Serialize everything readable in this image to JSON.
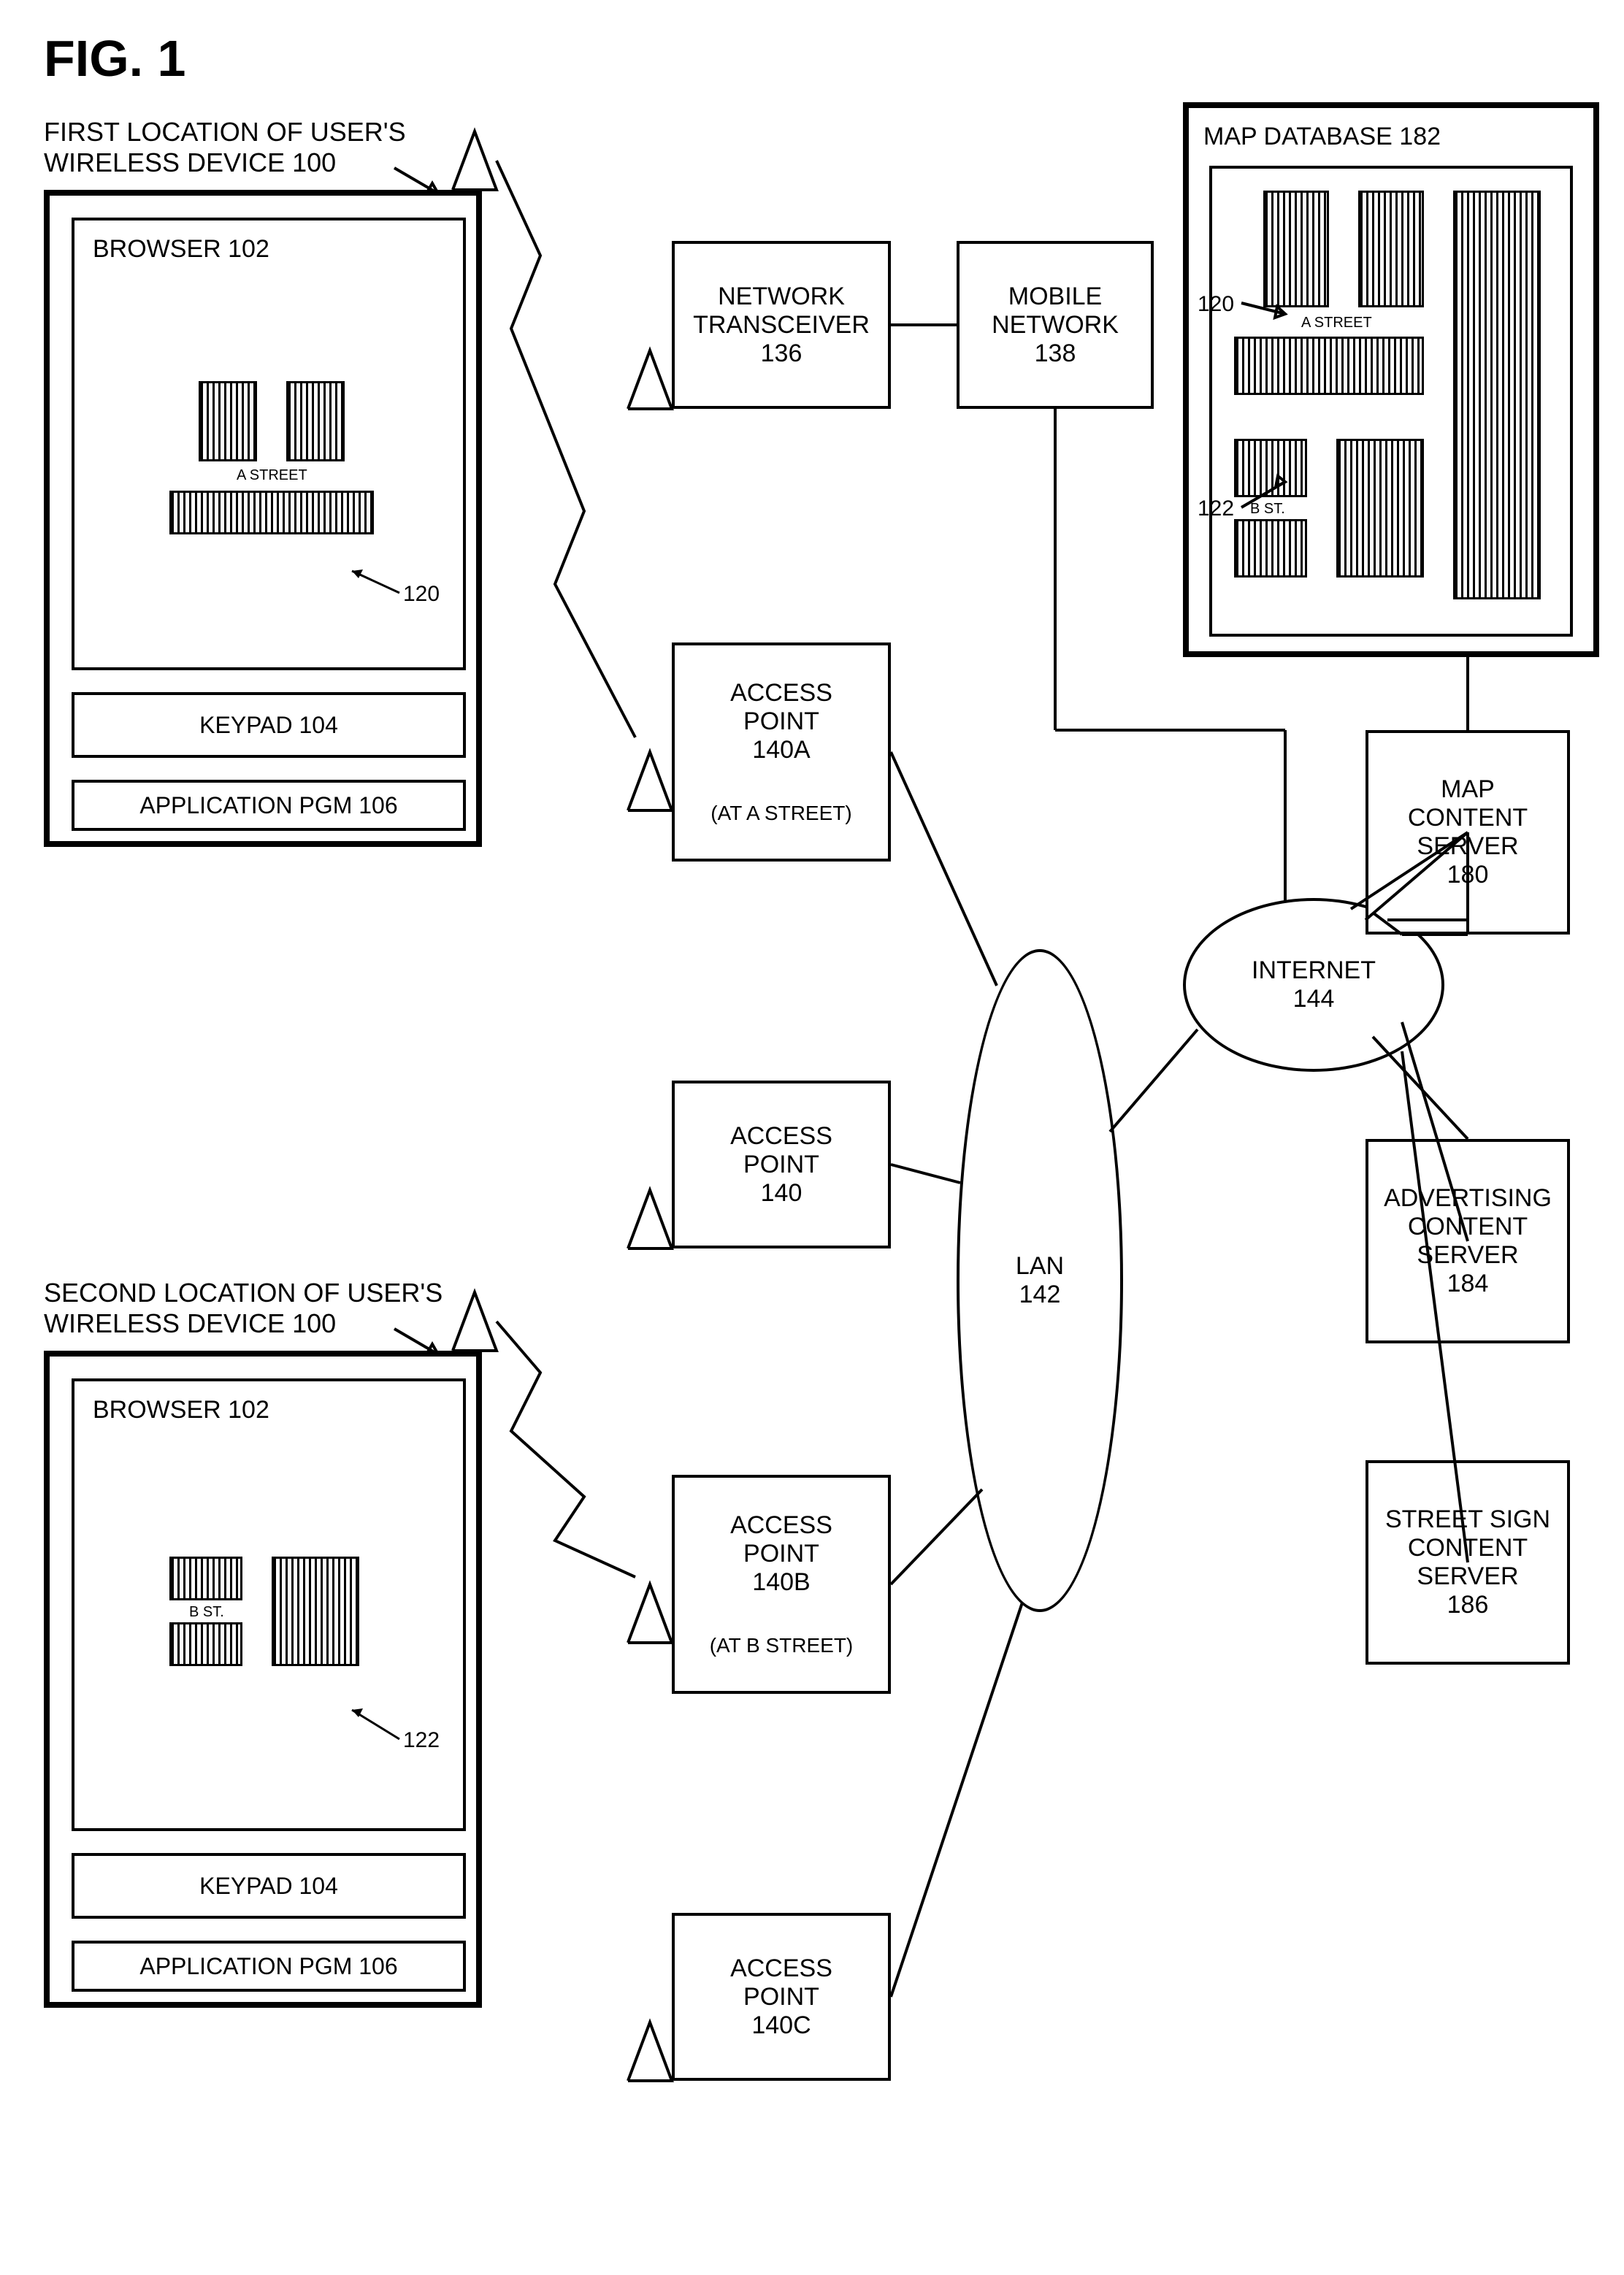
{
  "figure": "FIG. 1",
  "devices": {
    "device1": {
      "title_line1": "FIRST LOCATION OF USER'S",
      "title_line2": "WIRELESS DEVICE 100",
      "browser": "BROWSER 102",
      "keypad": "KEYPAD 104",
      "app": "APPLICATION PGM 106",
      "street": "A STREET",
      "ref": "120"
    },
    "device2": {
      "title_line1": "SECOND LOCATION OF USER'S",
      "title_line2": "WIRELESS DEVICE 100",
      "browser": "BROWSER 102",
      "keypad": "KEYPAD 104",
      "app": "APPLICATION PGM 106",
      "street": "B ST.",
      "ref": "122"
    }
  },
  "nodes": {
    "network_transceiver": {
      "l1": "NETWORK",
      "l2": "TRANSCEIVER",
      "l3": "136"
    },
    "mobile_network": {
      "l1": "MOBILE",
      "l2": "NETWORK",
      "l3": "138"
    },
    "ap140a": {
      "l1": "ACCESS",
      "l2": "POINT",
      "l3": "140A",
      "loc": "(AT A STREET)"
    },
    "ap140": {
      "l1": "ACCESS",
      "l2": "POINT",
      "l3": "140"
    },
    "ap140b": {
      "l1": "ACCESS",
      "l2": "POINT",
      "l3": "140B",
      "loc": "(AT B STREET)"
    },
    "ap140c": {
      "l1": "ACCESS",
      "l2": "POINT",
      "l3": "140C"
    },
    "lan": {
      "l1": "LAN",
      "l2": "142"
    },
    "internet": {
      "l1": "INTERNET",
      "l2": "144"
    },
    "map_server": {
      "l1": "MAP",
      "l2": "CONTENT",
      "l3": "SERVER",
      "l4": "180"
    },
    "ad_server": {
      "l1": "ADVERTISING",
      "l2": "CONTENT",
      "l3": "SERVER",
      "l4": "184"
    },
    "sign_server": {
      "l1": "STREET SIGN",
      "l2": "CONTENT",
      "l3": "SERVER",
      "l4": "186"
    },
    "map_db": {
      "title": "MAP DATABASE 182",
      "streetA": "A STREET",
      "streetB": "B ST.",
      "ref1": "120",
      "ref2": "122"
    }
  }
}
